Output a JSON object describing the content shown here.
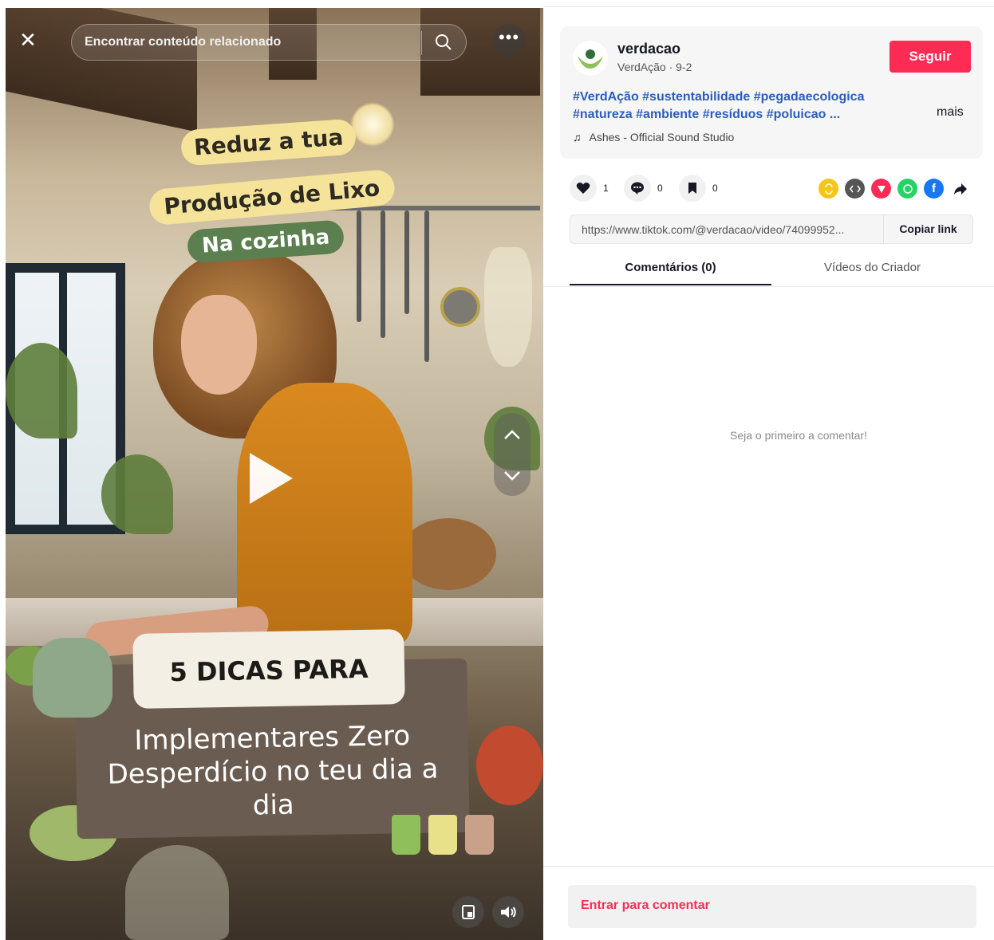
{
  "video": {
    "search_placeholder": "Encontrar conteúdo relacionado",
    "sticker_line1": "Reduz a tua",
    "sticker_line2": "Produção de Lixo",
    "sticker_line3": "Na cozinha",
    "card_title": "5 DICAS PARA",
    "card_text": "Implementares Zero Desperdício no teu dia a dia",
    "icons": {
      "close": "close-icon",
      "search": "search-icon",
      "more": "more-icon",
      "play": "play-icon",
      "up": "chevron-up-icon",
      "down": "chevron-down-icon",
      "miniplayer": "miniplayer-icon",
      "volume": "volume-icon"
    }
  },
  "creator": {
    "username": "verdacao",
    "display_name": "VerdAção",
    "date": "9-2",
    "follow_label": "Seguir",
    "hashtags": "#VerdAção #sustentabilidade #pegadaecologica #natureza #ambiente #resíduos #poluicao ...",
    "more_label": "mais",
    "music": "Ashes - Official Sound Studio"
  },
  "actions": {
    "likes": "1",
    "comments": "0",
    "saves": "0"
  },
  "share_icons": [
    "repost-icon",
    "embed-icon",
    "send-icon",
    "whatsapp-icon",
    "facebook-icon",
    "share-arrow-icon"
  ],
  "link": {
    "url": "https://www.tiktok.com/@verdacao/video/74099952...",
    "copy_label": "Copiar link"
  },
  "tabs": {
    "comments": "Comentários (0)",
    "creator_videos": "Vídeos do Criador"
  },
  "empty_comments": "Seja o primeiro a comentar!",
  "login_prompt": "Entrar para comentar",
  "colors": {
    "accent": "#fe2c55",
    "hashtag": "#2b5db9",
    "sticker_yellow": "#f5e39a",
    "sticker_green": "#5b7f4e",
    "card_brown": "#6b5c51"
  }
}
